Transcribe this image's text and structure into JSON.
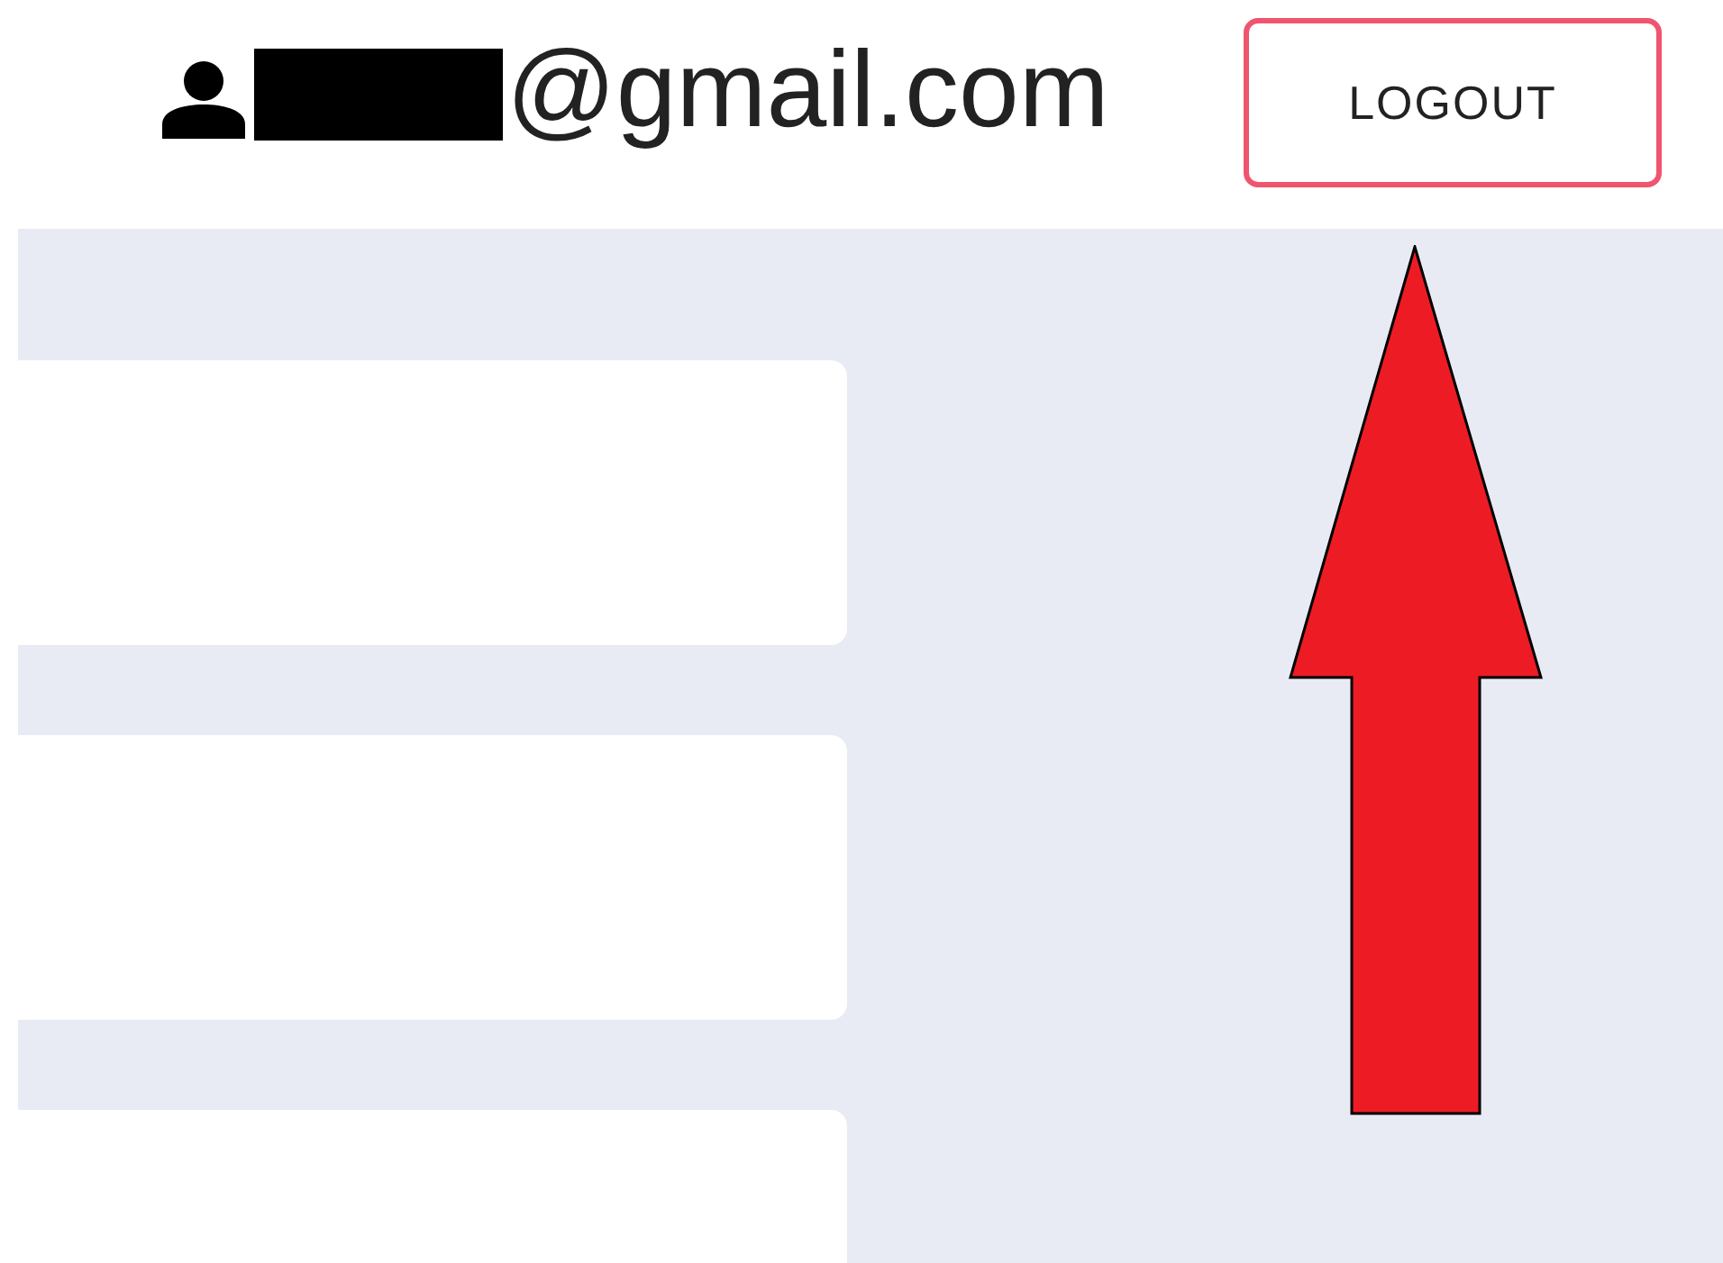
{
  "header": {
    "user_email": "@gmail.com",
    "logout_button": "LOGOUT"
  }
}
